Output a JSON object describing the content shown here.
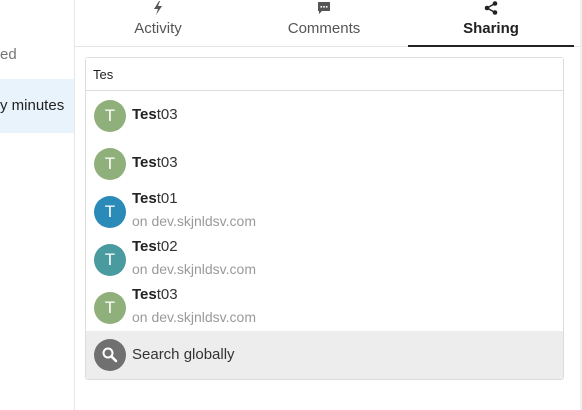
{
  "left_list": {
    "row1_text": "ed",
    "row2_text": "y minutes"
  },
  "tabs": [
    {
      "label": "Activity",
      "icon": "lightning-icon"
    },
    {
      "label": "Comments",
      "icon": "comment-icon"
    },
    {
      "label": "Sharing",
      "icon": "share-icon",
      "active": true
    }
  ],
  "search": {
    "value": "Tes",
    "results": [
      {
        "match": "Tes",
        "rest": "t03",
        "avatar_letter": "T",
        "avatar_color": "#8fb07b",
        "server": ""
      },
      {
        "match": "Tes",
        "rest": "t03",
        "avatar_letter": "T",
        "avatar_color": "#8fb07b",
        "server": ""
      },
      {
        "match": "Tes",
        "rest": "t01",
        "avatar_letter": "T",
        "avatar_color": "#2a8bb8",
        "server": "on dev.skjnldsv.com"
      },
      {
        "match": "Tes",
        "rest": "t02",
        "avatar_letter": "T",
        "avatar_color": "#4a9ba0",
        "server": "on dev.skjnldsv.com"
      },
      {
        "match": "Tes",
        "rest": "t03",
        "avatar_letter": "T",
        "avatar_color": "#8fb07b",
        "server": "on dev.skjnldsv.com"
      }
    ],
    "global_label": "Search globally",
    "global_icon": "search-icon"
  }
}
